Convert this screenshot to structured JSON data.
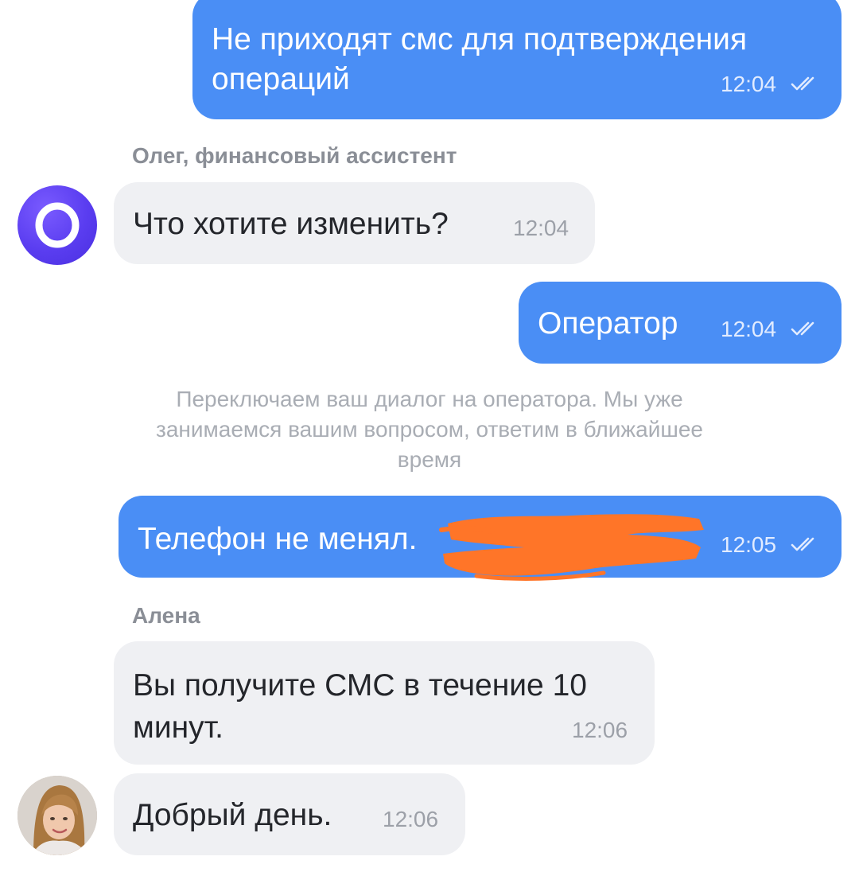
{
  "messages": [
    {
      "id": "m1",
      "direction": "outgoing",
      "lines": [
        "Не приходят смс для подтверждения",
        "операций"
      ],
      "time": "12:04",
      "status": "read"
    },
    {
      "id": "m2",
      "direction": "incoming",
      "sender": "Олег, финансовый ассистент",
      "avatar_letter": "O",
      "text": "Что хотите изменить?",
      "time": "12:04"
    },
    {
      "id": "m3",
      "direction": "outgoing",
      "text": "Оператор",
      "time": "12:04",
      "status": "read"
    },
    {
      "id": "m4",
      "direction": "system",
      "lines": [
        "Переключаем ваш диалог на оператора. Мы уже",
        "занимаемся вашим вопросом, ответим в ближайшее",
        "время"
      ]
    },
    {
      "id": "m5",
      "direction": "outgoing",
      "text": "Телефон не менял.",
      "redacted": true,
      "time": "12:05",
      "status": "read"
    },
    {
      "id": "m6",
      "direction": "incoming",
      "sender": "Алена",
      "lines": [
        "Вы получите СМС в течение 10",
        "минут."
      ],
      "time": "12:06"
    },
    {
      "id": "m7",
      "direction": "incoming",
      "text": "Добрый день.",
      "time": "12:06"
    }
  ],
  "colors": {
    "outgoing_bubble": "#4a8ef5",
    "incoming_bubble": "#eff0f3",
    "redaction": "#ff7528",
    "bot_avatar": "#5a3df0"
  },
  "icons": {
    "read_status": "double-check-icon",
    "operator_avatar": "user-photo-avatar"
  }
}
